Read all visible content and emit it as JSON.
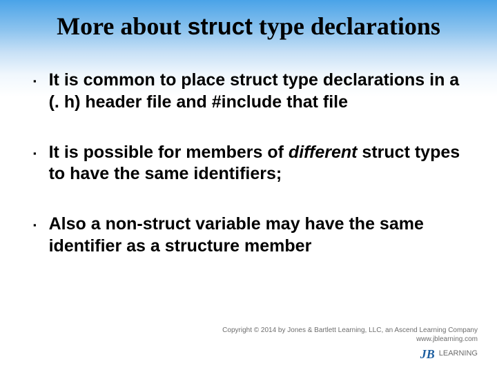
{
  "title": {
    "pre": "More about ",
    "code": "struct",
    "post": " type declarations"
  },
  "bullets": [
    {
      "html": "It is common to place struct type declarations in a (. h) header file and #include that file"
    },
    {
      "html": "It is possible for members of <em>different</em> struct types to have the same identifiers;"
    },
    {
      "html": "Also a non-struct variable may have the same identifier as a structure member"
    }
  ],
  "footer": {
    "copyright": "Copyright © 2014 by Jones & Bartlett Learning, LLC, an Ascend Learning Company",
    "url": "www.jblearning.com",
    "brand_initials": "JB",
    "brand_text": "LEARNING"
  }
}
